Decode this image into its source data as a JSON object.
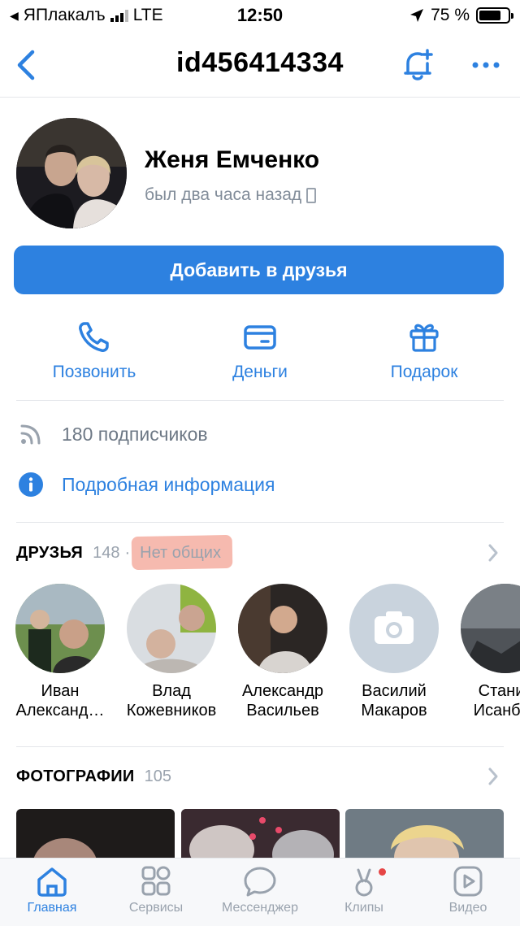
{
  "status_bar": {
    "back_app": "ЯПлакалъ",
    "network": "LTE",
    "time": "12:50",
    "battery": "75 %",
    "battery_level": 0.75
  },
  "header": {
    "title": "id456414334"
  },
  "profile": {
    "name": "Женя Емченко",
    "last_seen": "был два часа назад",
    "add_friend_label": "Добавить в друзья"
  },
  "actions": [
    {
      "label": "Позвонить",
      "icon": "phone-icon"
    },
    {
      "label": "Деньги",
      "icon": "money-card-icon"
    },
    {
      "label": "Подарок",
      "icon": "gift-icon"
    }
  ],
  "info": {
    "followers": "180 подписчиков",
    "details": "Подробная информация"
  },
  "friends_section": {
    "title": "ДРУЗЬЯ",
    "count": "148",
    "separator": "·",
    "mutual": "Нет общих",
    "items": [
      {
        "line1": "Иван",
        "line2": "Александ…"
      },
      {
        "line1": "Влад",
        "line2": "Кожевников"
      },
      {
        "line1": "Александр",
        "line2": "Васильев"
      },
      {
        "line1": "Василий",
        "line2": "Макаров"
      },
      {
        "line1": "Станис",
        "line2": "Исанбул"
      }
    ]
  },
  "photos_section": {
    "title": "ФОТОГРАФИИ",
    "count": "105"
  },
  "tabbar": [
    {
      "label": "Главная",
      "icon": "home-icon",
      "active": true
    },
    {
      "label": "Сервисы",
      "icon": "services-icon",
      "active": false
    },
    {
      "label": "Мессенджер",
      "icon": "messenger-icon",
      "active": false
    },
    {
      "label": "Клипы",
      "icon": "clips-icon",
      "active": false
    },
    {
      "label": "Видео",
      "icon": "video-icon",
      "active": false
    }
  ],
  "colors": {
    "accent": "#2d81e0",
    "secondary_text": "#818c99",
    "highlight": "#f3a394",
    "badge": "#e64646"
  }
}
